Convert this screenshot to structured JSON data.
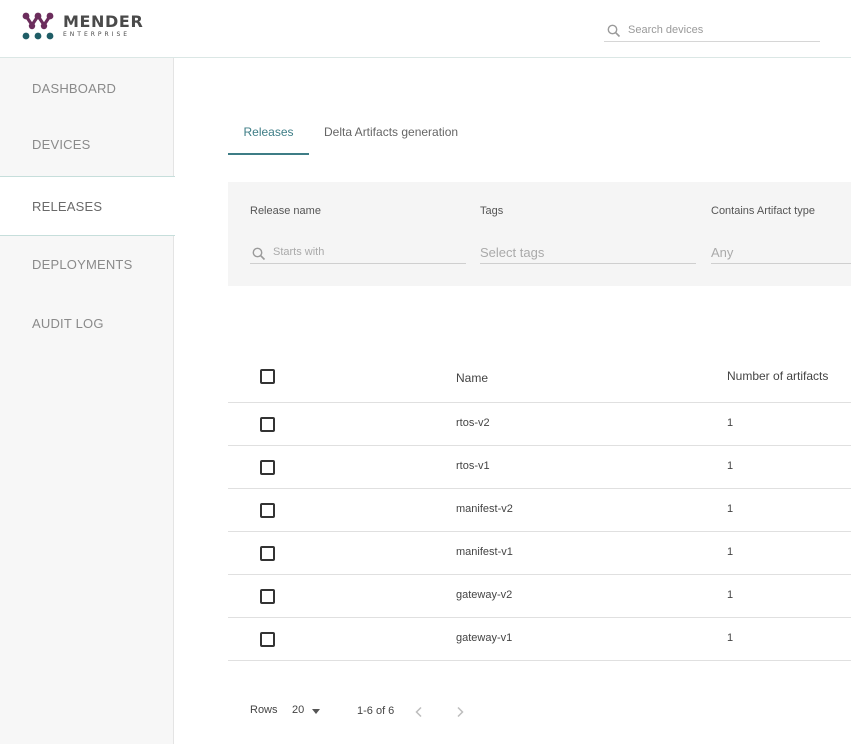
{
  "header": {
    "logo_word": "MENDER",
    "logo_sub": "ENTERPRISE",
    "search_placeholder": "Search devices"
  },
  "sidebar": {
    "items": [
      {
        "label": "DASHBOARD"
      },
      {
        "label": "DEVICES"
      },
      {
        "label": "RELEASES",
        "active": true
      },
      {
        "label": "DEPLOYMENTS"
      },
      {
        "label": "AUDIT LOG"
      }
    ]
  },
  "tabs": [
    {
      "label": "Releases",
      "active": true
    },
    {
      "label": "Delta Artifacts generation"
    }
  ],
  "filters": {
    "release_name_label": "Release name",
    "release_name_placeholder": "Starts with",
    "tags_label": "Tags",
    "tags_placeholder": "Select tags",
    "artifact_type_label": "Contains Artifact type",
    "artifact_type_value": "Any"
  },
  "table": {
    "headers": {
      "name": "Name",
      "artifacts": "Number of artifacts"
    },
    "rows": [
      {
        "name": "rtos-v2",
        "artifacts": "1"
      },
      {
        "name": "rtos-v1",
        "artifacts": "1"
      },
      {
        "name": "manifest-v2",
        "artifacts": "1"
      },
      {
        "name": "manifest-v1",
        "artifacts": "1"
      },
      {
        "name": "gateway-v2",
        "artifacts": "1"
      },
      {
        "name": "gateway-v1",
        "artifacts": "1"
      }
    ]
  },
  "pagination": {
    "rows_label": "Rows",
    "rows_value": "20",
    "range": "1-6 of 6"
  },
  "colors": {
    "accent": "#3e7d86",
    "logo_purple": "#6b2d5c",
    "logo_teal": "#1f5d66"
  }
}
